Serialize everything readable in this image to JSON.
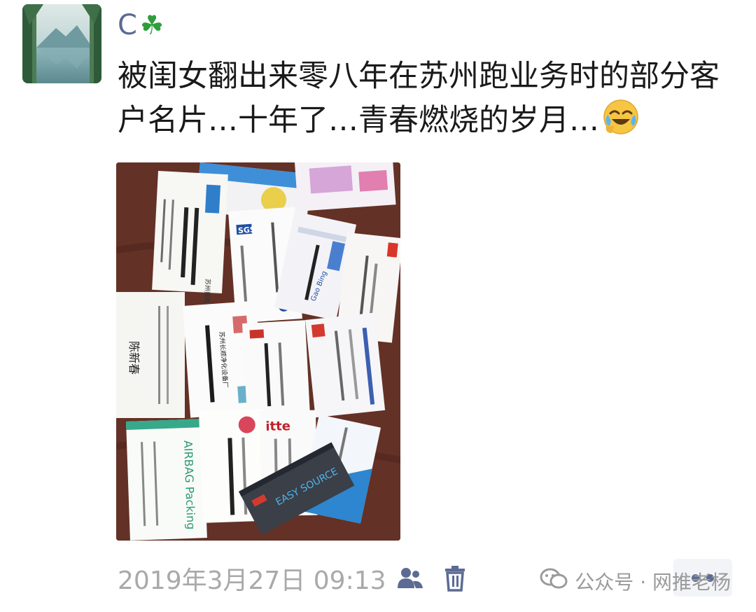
{
  "post": {
    "username": "C",
    "username_emoji": "☘",
    "text": "被闺女翻出来零八年在苏州跑业务时的部分客户名片…十年了…青春燃烧的岁月…",
    "emoji_name": "crying-laughing-face",
    "image_alt": "business-cards-photo"
  },
  "cards": {
    "c1": "苏州捷胜教育",
    "c2": "陈新春",
    "c3": "苏州长顺净化设备厂",
    "c4": "AIRBAG Packing",
    "c5": "itte",
    "c6": "EASY SOURCE",
    "c7": "Gao Bing",
    "c8": "SGS"
  },
  "footer": {
    "timestamp": "2019年3月27日 09:13",
    "privacy_icon": "people-icon",
    "delete_icon": "trash-icon"
  },
  "watermark": {
    "text": "公众号 · 网推老杨",
    "icon": "wechat-icon"
  },
  "colors": {
    "link_blue": "#5b6b93",
    "timestamp_gray": "#a9a9a9",
    "table_wood": "#5a2b22"
  }
}
